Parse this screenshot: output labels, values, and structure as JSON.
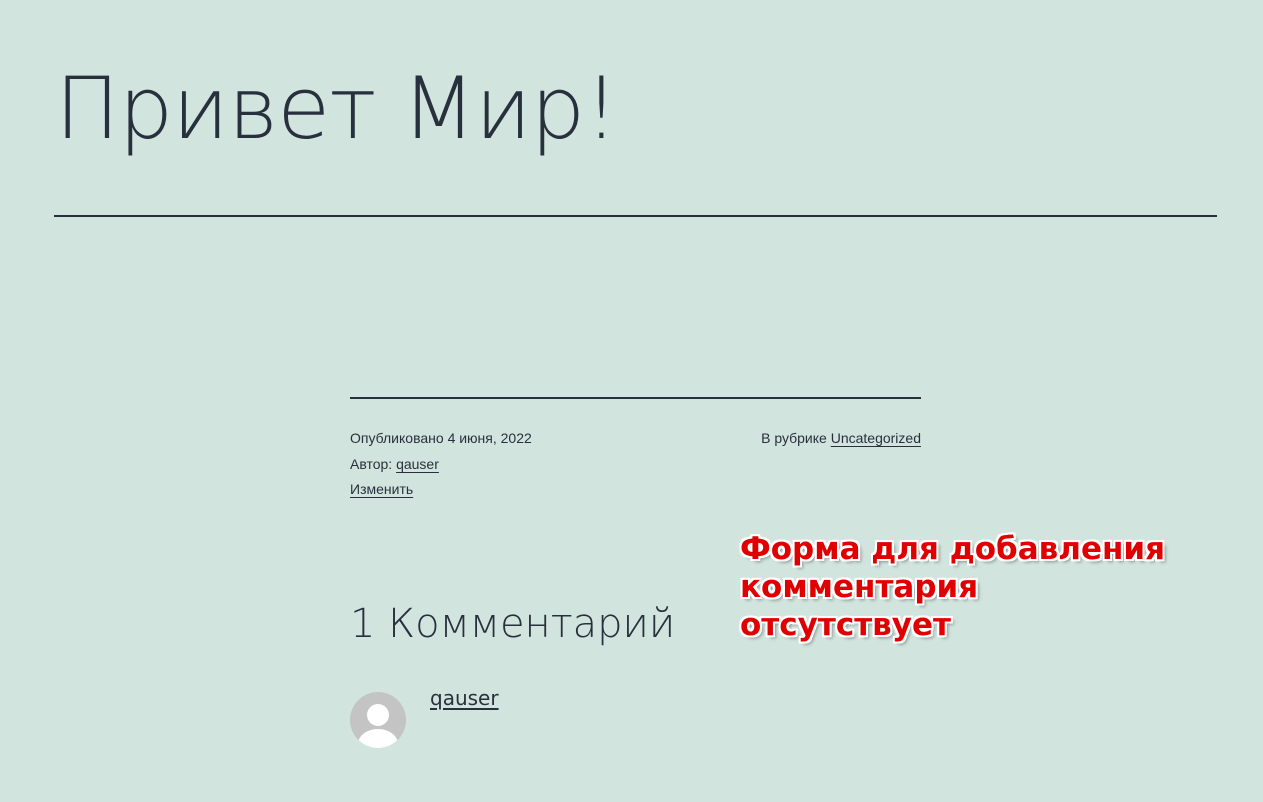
{
  "post": {
    "title": "Привет Мир!"
  },
  "meta": {
    "published_prefix": "Опубликовано ",
    "published_date": "4 июня, 2022",
    "author_prefix": "Автор: ",
    "author_name": "qauser",
    "edit_label": "Изменить",
    "category_prefix": "В рубрике ",
    "category_name": "Uncategorized"
  },
  "comments": {
    "title": "1 Комментарий",
    "items": [
      {
        "author": "qauser"
      }
    ]
  },
  "annotation": {
    "lines": [
      "Форма для добавления",
      "комментария",
      "отсутствует"
    ],
    "color": "#e00000"
  },
  "colors": {
    "background": "#d1e4dd",
    "text": "#28303d"
  },
  "icons": {
    "avatar": "default-avatar-icon"
  }
}
